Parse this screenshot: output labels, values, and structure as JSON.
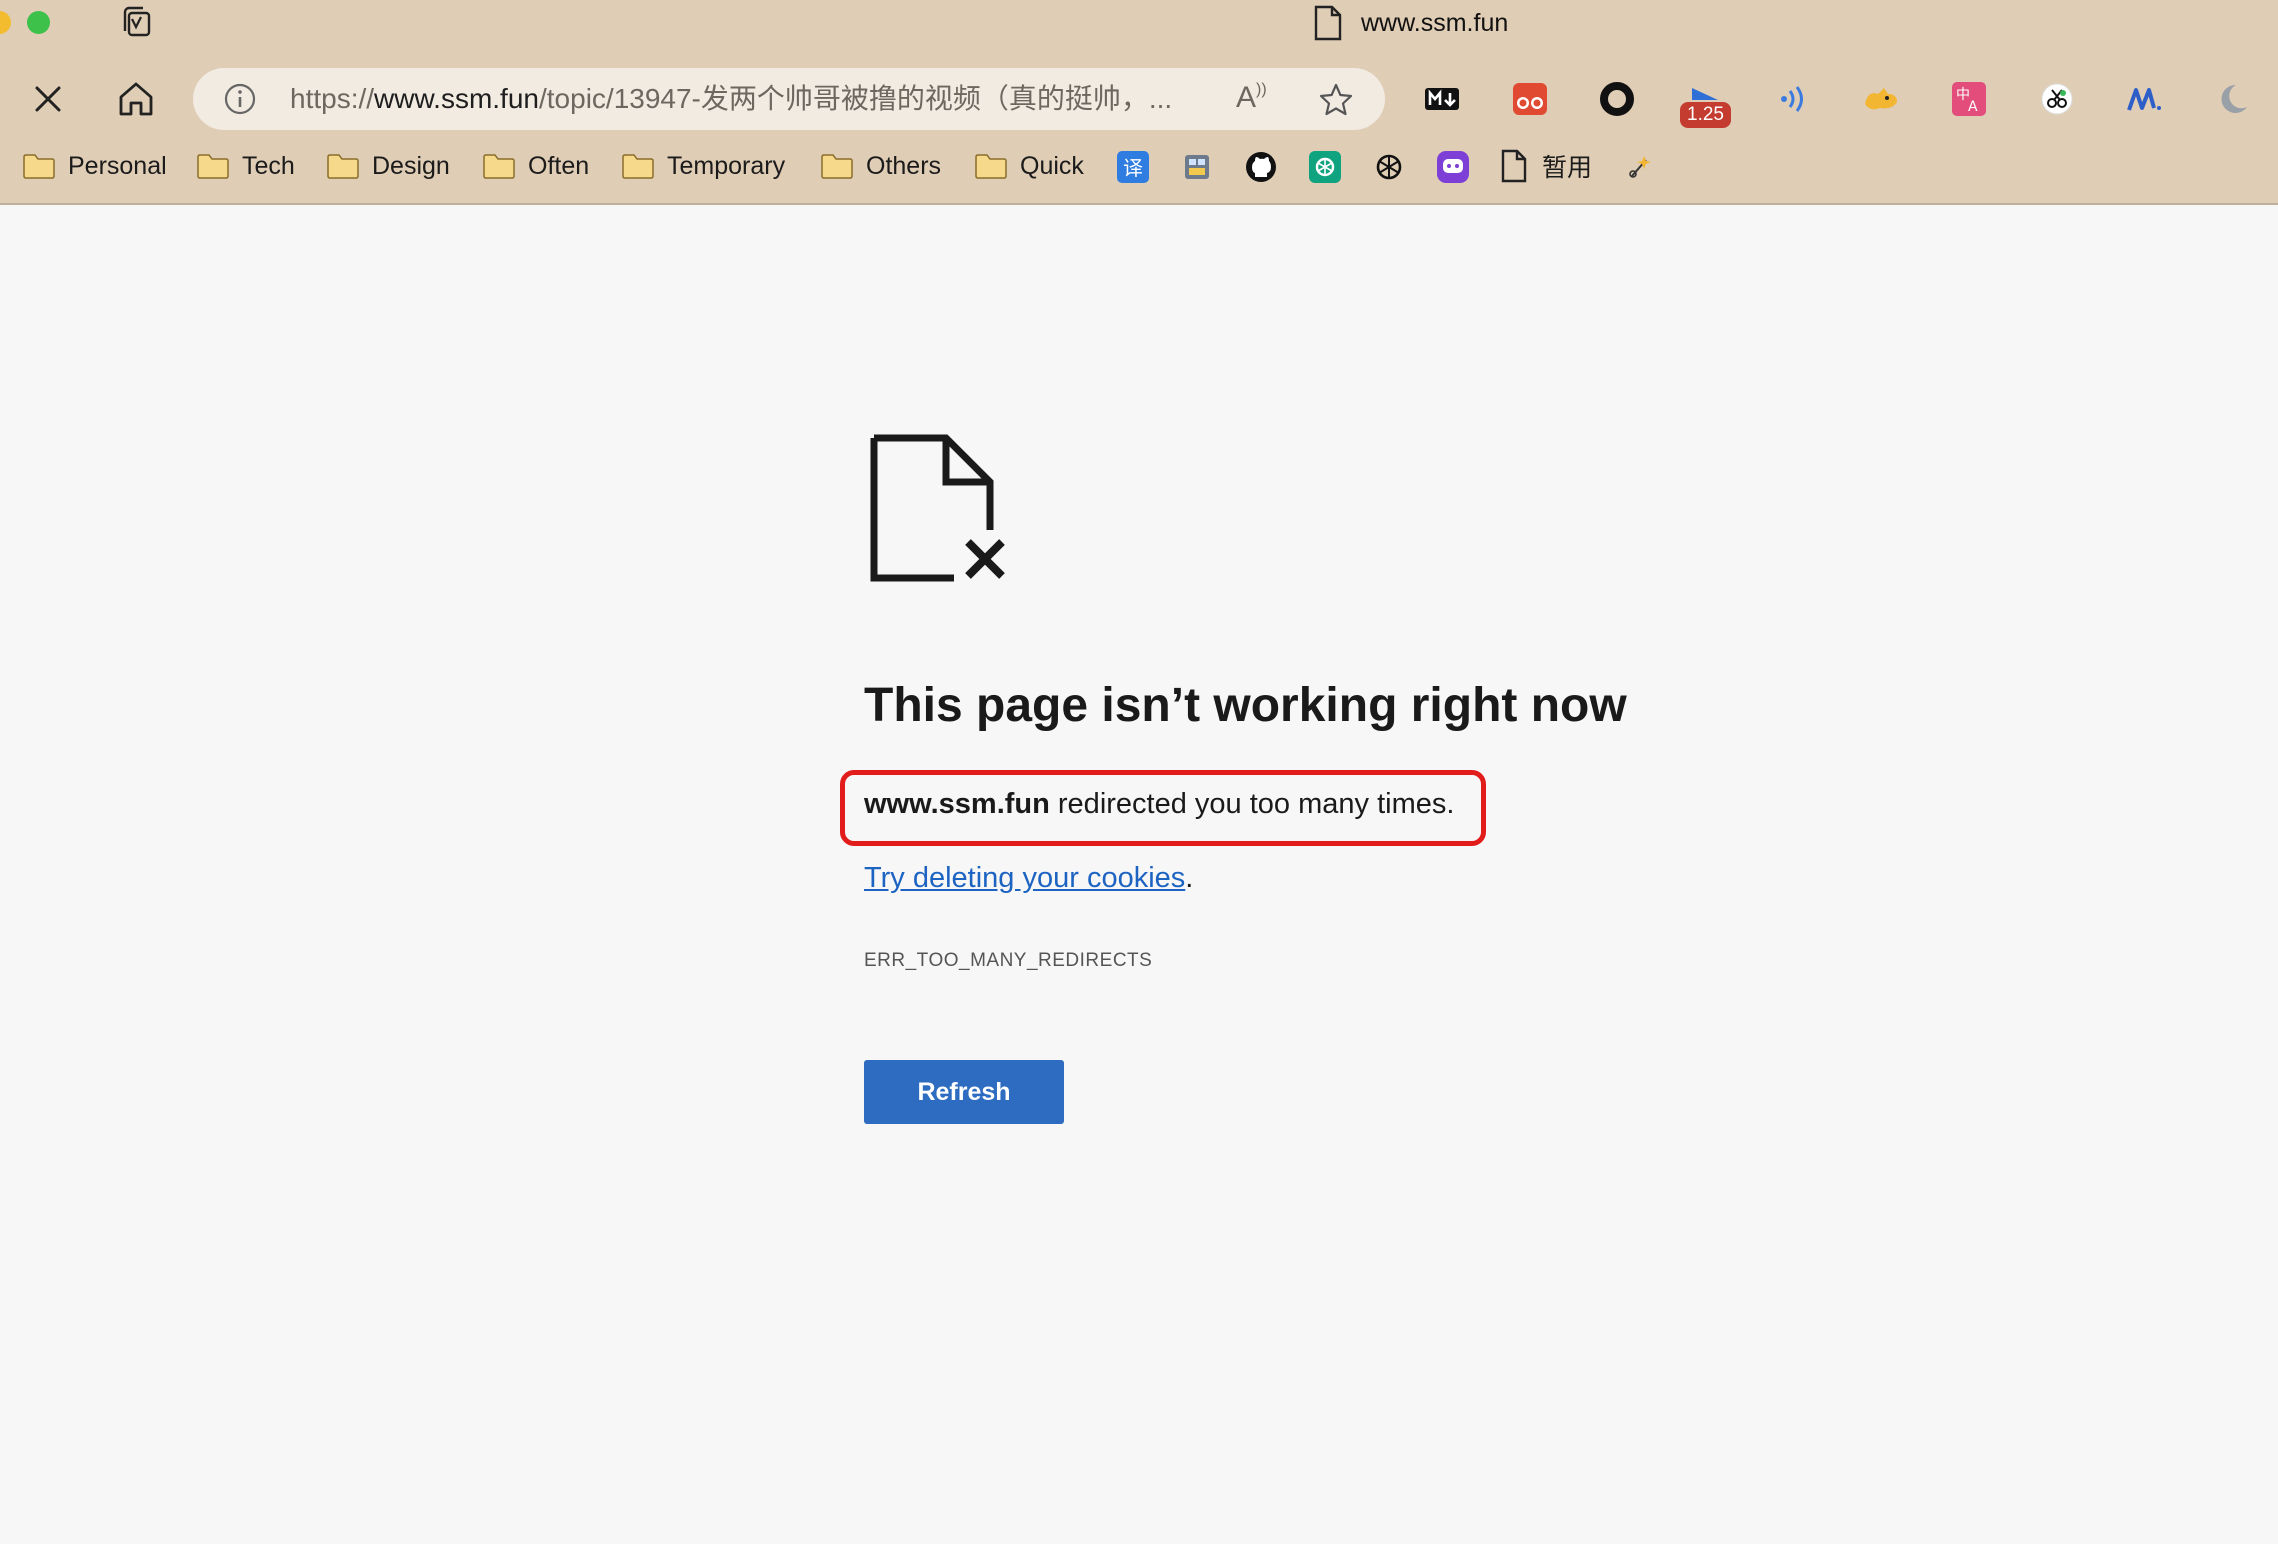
{
  "window": {
    "tab_title": "www.ssm.fun"
  },
  "toolbar": {
    "url_scheme": "https://",
    "url_domain": "www.ssm.fun",
    "url_path": "/topic/13947-发两个帅哥被撸的视频（真的挺帅，...",
    "read_aloud_label": "A",
    "extension_badge": "1.25"
  },
  "bookmarks": {
    "folders": [
      "Personal",
      "Tech",
      "Design",
      "Often",
      "Temporary",
      "Others",
      "Quick"
    ],
    "translate_label": "译",
    "page_label": "暂用"
  },
  "error": {
    "headline": "This page isn’t working right now",
    "domain": "www.ssm.fun",
    "message": " redirected you too many times.",
    "suggestion_link": "Try deleting your cookies",
    "suggestion_suffix": ".",
    "error_code": "ERR_TOO_MANY_REDIRECTS",
    "refresh_label": "Refresh"
  },
  "colors": {
    "chrome_bg": "#dfcdb5",
    "page_bg": "#f7f7f7",
    "link": "#1d64c2",
    "button": "#2d6cc1",
    "highlight": "#e21b1b"
  }
}
